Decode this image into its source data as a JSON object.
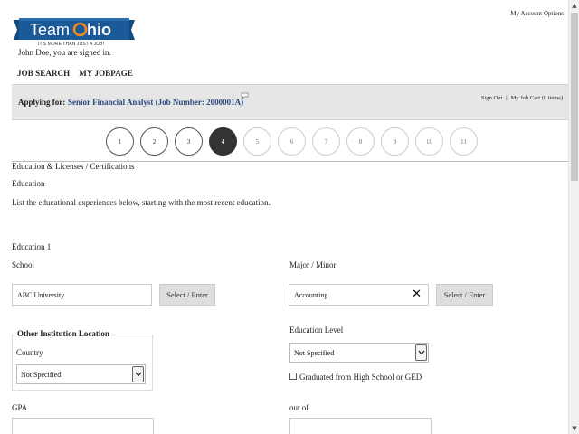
{
  "header": {
    "logo_text": "TeamOhio",
    "tagline": "IT'S MORE THAN JUST A JOB!",
    "signed_in_text": "John Doe, you are signed in.",
    "account_options": "My Account Options"
  },
  "nav": {
    "job_search": "JOB SEARCH",
    "my_jobpage": "MY JOBPAGE"
  },
  "apply_bar": {
    "label": "Applying for:",
    "job": "Senior Financial Analyst (Job Number: 2000001A)",
    "sign_out": "Sign Out",
    "separator": "|",
    "job_cart": "My Job Cart (0 items)"
  },
  "steps": [
    "1",
    "2",
    "3",
    "4",
    "5",
    "6",
    "7",
    "8",
    "9",
    "10",
    "11"
  ],
  "active_step": "4",
  "content": {
    "section_title": "Education & Licenses / Certifications",
    "subsection": "Education",
    "instructions": "List the educational experiences below, starting with the most recent education.",
    "entry_title": "Education 1",
    "school_label": "School",
    "school_value": "ABC University",
    "select_enter": "Select / Enter",
    "major_label": "Major / Minor",
    "major_value": "Accounting",
    "other_location_legend": "Other Institution Location",
    "country_label": "Country",
    "country_value": "Not Specified",
    "education_level_label": "Education Level",
    "education_level_value": "Not Specified",
    "graduated_label": "Graduated from High School or GED",
    "gpa_label": "GPA",
    "out_of_label": "out of",
    "gpa_value": "",
    "out_of_value": ""
  },
  "colors": {
    "brand_blue": "#1b4f86",
    "brand_orange": "#f08a1c",
    "job_link": "#2a4a7f",
    "active_step": "#333333"
  }
}
